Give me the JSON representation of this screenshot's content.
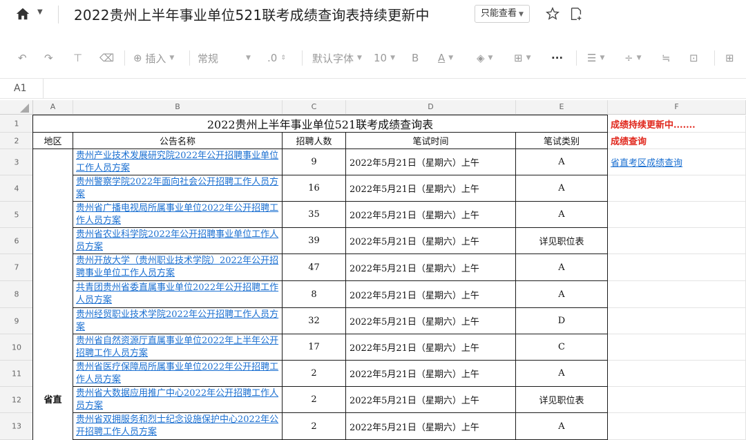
{
  "window": {
    "title": "2022贵州上半年事业单位521联考成绩查询表持续更新中",
    "view_mode": "只能查看"
  },
  "toolbar": {
    "insert_label": "插入",
    "format_label": "常规",
    "decimal_label": ".0",
    "font_label": "默认字体",
    "font_size": "10",
    "bold_label": "B",
    "color_label": "A",
    "more_label": "···"
  },
  "formula_bar": {
    "cell_ref": "A1"
  },
  "columns": [
    "A",
    "B",
    "C",
    "D",
    "E",
    "F"
  ],
  "rows": [
    "1",
    "2",
    "3",
    "4",
    "5",
    "6",
    "7",
    "8",
    "9",
    "10",
    "11",
    "12",
    "13"
  ],
  "sheet": {
    "title": "2022贵州上半年事业单位521联考成绩查询表",
    "headers": {
      "region": "地区",
      "name": "公告名称",
      "count": "招聘人数",
      "time": "笔试时间",
      "type": "笔试类别"
    },
    "region_value": "省直",
    "side": {
      "updating": "成绩持续更新中.......",
      "query": "成绩查询",
      "link": "省直考区成绩查询"
    },
    "records": [
      {
        "name": "贵州产业技术发展研究院2022年公开招聘事业单位工作人员方案",
        "count": "9",
        "time": "2022年5月21日（星期六）上午",
        "type": "A"
      },
      {
        "name": "贵州警察学院2022年面向社会公开招聘工作人员方案",
        "count": "16",
        "time": "2022年5月21日（星期六）上午",
        "type": "A"
      },
      {
        "name": "贵州省广播电视局所属事业单位2022年公开招聘工作人员方案",
        "count": "35",
        "time": "2022年5月21日（星期六）上午",
        "type": "A"
      },
      {
        "name": "贵州省农业科学院2022年公开招聘事业单位工作人员方案",
        "count": "39",
        "time": "2022年5月21日（星期六）上午",
        "type": "详见职位表"
      },
      {
        "name": "贵州开放大学（贵州职业技术学院）2022年公开招聘事业单位工作人员方案",
        "count": "47",
        "time": "2022年5月21日（星期六）上午",
        "type": "A"
      },
      {
        "name": "共青团贵州省委直属事业单位2022年公开招聘工作人员方案",
        "count": "8",
        "time": "2022年5月21日（星期六）上午",
        "type": "A"
      },
      {
        "name": "贵州经贸职业技术学院2022年公开招聘工作人员方案",
        "count": "32",
        "time": "2022年5月21日（星期六）上午",
        "type": "D"
      },
      {
        "name": "贵州省自然资源厅直属事业单位2022年上半年公开招聘工作人员方案",
        "count": "17",
        "time": "2022年5月21日（星期六）上午",
        "type": "C"
      },
      {
        "name": "贵州省医疗保障局所属事业单位2022年公开招聘工作人员方案",
        "count": "2",
        "time": "2022年5月21日（星期六）上午",
        "type": "A"
      },
      {
        "name": "贵州省大数据应用推广中心2022年公开招聘工作人员方案",
        "count": "2",
        "time": "2022年5月21日（星期六）上午",
        "type": "详见职位表"
      },
      {
        "name": "贵州省双拥服务和烈士纪念设施保护中心2022年公开招聘工作人员方案",
        "count": "2",
        "time": "2022年5月21日（星期六）上午",
        "type": "A"
      }
    ]
  }
}
